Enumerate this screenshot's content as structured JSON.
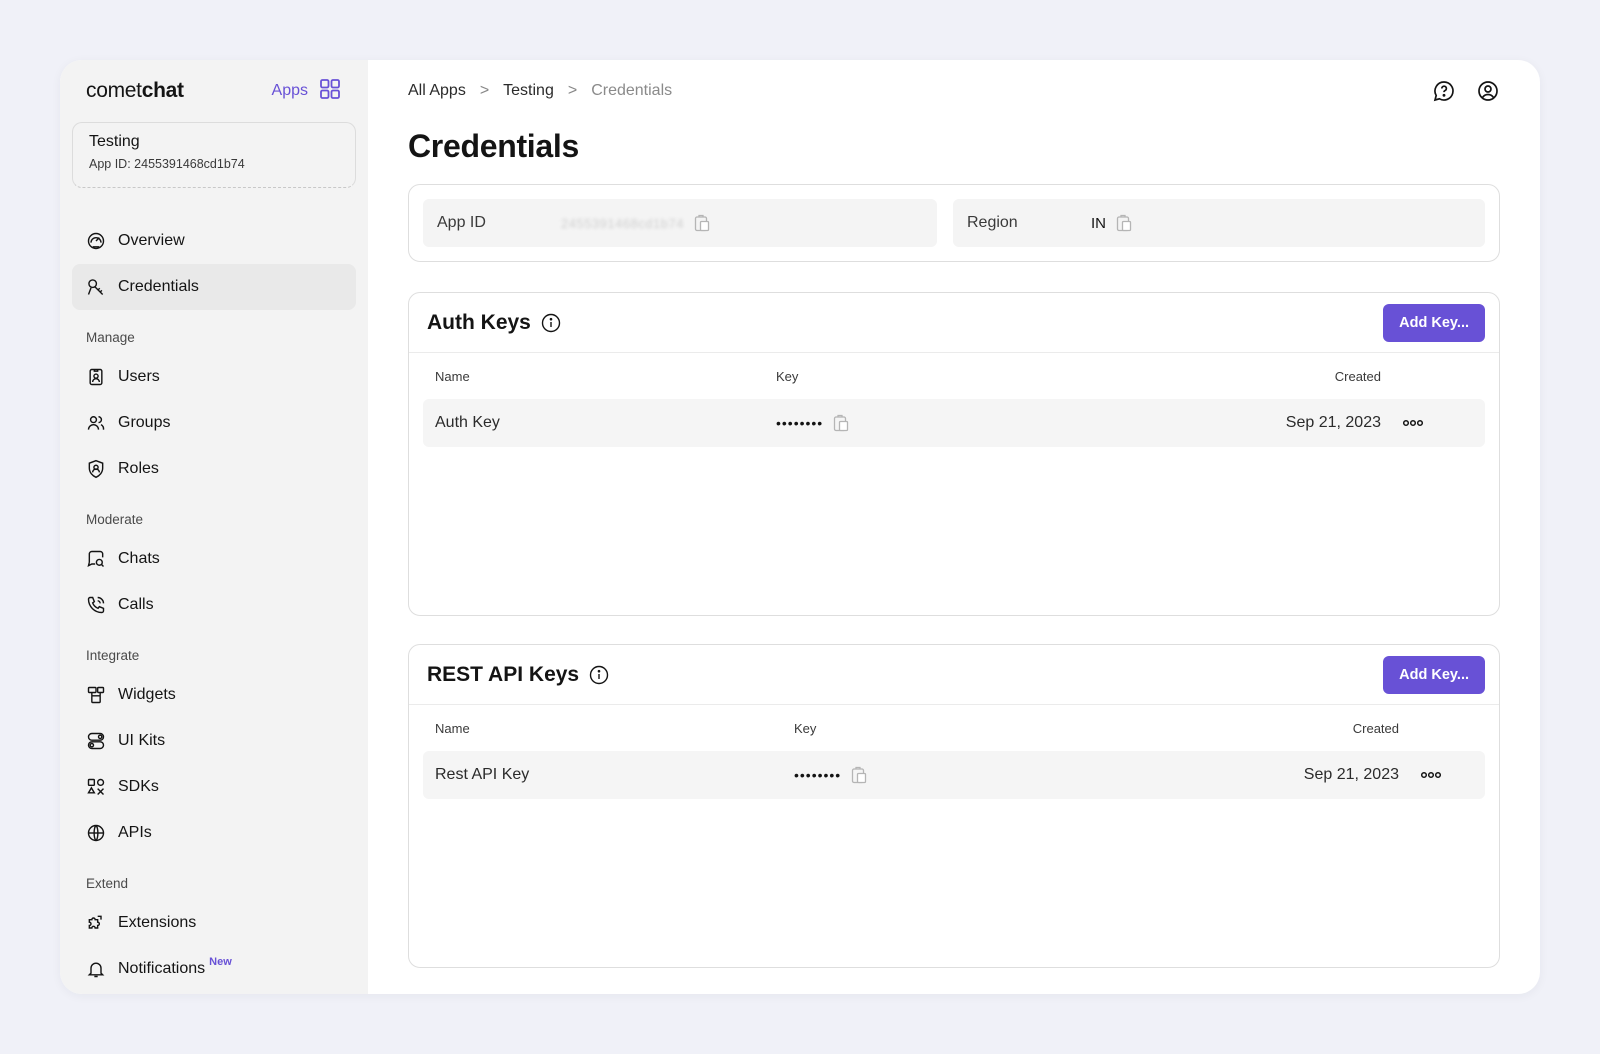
{
  "sidebar": {
    "logo_light": "comet",
    "logo_bold": "chat",
    "apps_label": "Apps",
    "app": {
      "name": "Testing",
      "id_text": "App ID: 2455391468cd1b74"
    },
    "top_items": [
      {
        "label": "Overview",
        "icon": "dashboard-icon"
      },
      {
        "label": "Credentials",
        "icon": "keys-icon",
        "active": true
      }
    ],
    "sections": [
      {
        "label": "Manage",
        "items": [
          {
            "label": "Users",
            "icon": "user-badge-icon"
          },
          {
            "label": "Groups",
            "icon": "groups-icon"
          },
          {
            "label": "Roles",
            "icon": "shield-user-icon"
          }
        ]
      },
      {
        "label": "Moderate",
        "items": [
          {
            "label": "Chats",
            "icon": "chat-search-icon"
          },
          {
            "label": "Calls",
            "icon": "phone-icon"
          }
        ]
      },
      {
        "label": "Integrate",
        "items": [
          {
            "label": "Widgets",
            "icon": "widget-icon"
          },
          {
            "label": "UI Kits",
            "icon": "toggles-icon"
          },
          {
            "label": "SDKs",
            "icon": "sdk-icon"
          },
          {
            "label": "APIs",
            "icon": "globe-icon"
          }
        ]
      },
      {
        "label": "Extend",
        "items": [
          {
            "label": "Extensions",
            "icon": "puzzle-icon"
          },
          {
            "label": "Notifications",
            "icon": "bell-icon",
            "badge": "New"
          }
        ]
      }
    ]
  },
  "breadcrumb": {
    "root": "All Apps",
    "app": "Testing",
    "current": "Credentials",
    "separator": ">"
  },
  "page_title": "Credentials",
  "info": {
    "app_id_label": "App ID",
    "app_id_value": "2455391468cd1b74",
    "region_label": "Region",
    "region_value": "IN"
  },
  "auth_keys": {
    "title": "Auth Keys",
    "add_button": "Add Key...",
    "columns": {
      "name": "Name",
      "key": "Key",
      "created": "Created"
    },
    "rows": [
      {
        "name": "Auth Key",
        "key": "••••••••",
        "created": "Sep 21, 2023"
      }
    ]
  },
  "rest_keys": {
    "title": "REST API Keys",
    "add_button": "Add Key...",
    "columns": {
      "name": "Name",
      "key": "Key",
      "created": "Created"
    },
    "rows": [
      {
        "name": "Rest API Key",
        "key": "••••••••",
        "created": "Sep 21, 2023"
      }
    ]
  },
  "colors": {
    "accent": "#6851d6",
    "background": "#f0f1f8",
    "sidebar": "#f3f3f3"
  }
}
